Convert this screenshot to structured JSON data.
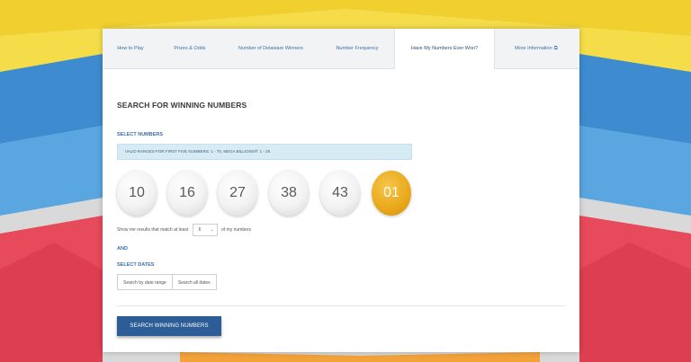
{
  "colors": {
    "accent": "#3c6fa8",
    "button": "#2c5d97",
    "mega_ball": "#e9a81a",
    "info_bg": "#d7ebf5"
  },
  "tabs": [
    {
      "label": "How to Play"
    },
    {
      "label": "Prizes & Odds"
    },
    {
      "label": "Number of Delaware Winners"
    },
    {
      "label": "Number Frequency"
    },
    {
      "label": "Have My Numbers Ever Won?",
      "active": true
    },
    {
      "label": "More Information",
      "icon": "external-link-icon"
    }
  ],
  "main": {
    "title": "SEARCH FOR WINNING NUMBERS",
    "select_numbers_label": "SELECT NUMBERS",
    "valid_ranges": "VALID RANGES FOR FIRST FIVE NUMBERS: 1 - 70, MEGA BILLIONS®: 1 - 25",
    "balls": [
      "10",
      "16",
      "27",
      "38",
      "43"
    ],
    "mega_ball": "01",
    "match_prefix": "Show me results that match at least",
    "match_value": "6",
    "match_suffix": "of my numbers",
    "and_label": "AND",
    "select_dates_label": "SELECT DATES",
    "date_range_button": "Search by date range",
    "all_dates_button": "Search all dates",
    "search_button": "SEARCH WINNING NUMBERS"
  }
}
